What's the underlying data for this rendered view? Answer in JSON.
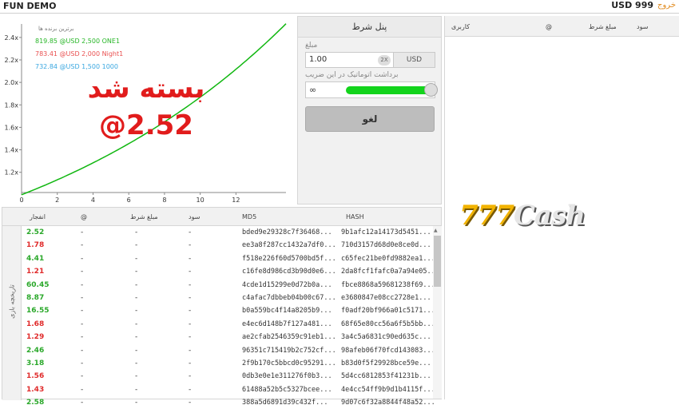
{
  "header": {
    "title": "FUN DEMO",
    "balance": "USD 999",
    "logout": "خروج"
  },
  "chart_data": {
    "type": "line",
    "title": "",
    "xlabel": "",
    "ylabel": "",
    "xlim": [
      0,
      14.8
    ],
    "ylim": [
      1.02,
      2.52
    ],
    "x_ticks": [
      0,
      2,
      4,
      6,
      8,
      10,
      12
    ],
    "y_ticks": [
      1.2,
      1.4,
      1.6,
      1.8,
      2.0,
      2.2,
      2.4
    ],
    "y_tick_labels": [
      "1.2x",
      "1.4x",
      "1.6x",
      "1.8x",
      "2.0x",
      "2.2x",
      "2.4x"
    ],
    "growth_rate": 0.0625,
    "end_x": 14.8,
    "final_multiplier": 2.52,
    "line_color": "#11b711"
  },
  "chart": {
    "leaderboard_title": "برترین برنده ها",
    "winners": [
      {
        "text": "819.85 @USD 2,500 ONE1",
        "color": "#27b627"
      },
      {
        "text": "783.41 @USD 2,000 Night1",
        "color": "#e95050"
      },
      {
        "text": "732.84 @USD 1,500 1000",
        "color": "#3aa7e0"
      }
    ],
    "crashed_label": "بسته شد",
    "crashed_value": "@2.52"
  },
  "bet_panel": {
    "title": "پنل شرط",
    "amount_label": "مبلغ",
    "amount_value": "1.00",
    "double_button": "2X",
    "currency": "USD",
    "auto_cashout_label": "برداشت اتوماتیک در این ضریب",
    "auto_cashout_value": "∞",
    "auto_cashout_level": 1.0,
    "cancel_button": "لغو"
  },
  "players": {
    "headers": {
      "user": "کاربری",
      "at": "@",
      "bet": "مبلغ شرط",
      "profit": "سود"
    },
    "logo_numeric": "777",
    "logo_text": "Cash"
  },
  "history": {
    "side_label": "تاریخچه بازی",
    "headers": {
      "crash": "انفجار",
      "at": "@",
      "bet": "مبلغ شرط",
      "profit": "سود",
      "md5": "MD5",
      "hash": "HASH"
    },
    "colors": {
      "win": "#2aa82a",
      "loss": "#e02a2a"
    },
    "rows": [
      {
        "crash": "2.52",
        "win": true,
        "at": "-",
        "bet": "-",
        "profit": "-",
        "md5": "bded9e29328c7f36468...",
        "hash": "9b1afc12a14173d5451..."
      },
      {
        "crash": "1.78",
        "win": false,
        "at": "-",
        "bet": "-",
        "profit": "-",
        "md5": "ee3a8f287cc1432a7df0...",
        "hash": "710d3157d68d0e8ce0d..."
      },
      {
        "crash": "4.41",
        "win": true,
        "at": "-",
        "bet": "-",
        "profit": "-",
        "md5": "f518e226f60d5700bd5f...",
        "hash": "c65fec21be0fd9882ea1..."
      },
      {
        "crash": "1.21",
        "win": false,
        "at": "-",
        "bet": "-",
        "profit": "-",
        "md5": "c16fe8d986cd3b90d0e6...",
        "hash": "2da8fcf1fafc0a7a94e05..."
      },
      {
        "crash": "60.45",
        "win": true,
        "at": "-",
        "bet": "-",
        "profit": "-",
        "md5": "4cde1d15299e0d72b0a...",
        "hash": "fbce8868a59681238f69..."
      },
      {
        "crash": "8.87",
        "win": true,
        "at": "-",
        "bet": "-",
        "profit": "-",
        "md5": "c4afac7dbbeb04b00c67...",
        "hash": "e3680847e08cc2728e1..."
      },
      {
        "crash": "16.55",
        "win": true,
        "at": "-",
        "bet": "-",
        "profit": "-",
        "md5": "b0a559bc4f14a8205b9...",
        "hash": "f0adf20bf966a01c5171..."
      },
      {
        "crash": "1.68",
        "win": false,
        "at": "-",
        "bet": "-",
        "profit": "-",
        "md5": "e4ec6d148b7f127a481...",
        "hash": "68f65e80cc56a6f5b5bb..."
      },
      {
        "crash": "1.29",
        "win": false,
        "at": "-",
        "bet": "-",
        "profit": "-",
        "md5": "ae2cfab2546359c91eb1...",
        "hash": "3a4c5a6831c90ed635c..."
      },
      {
        "crash": "2.46",
        "win": true,
        "at": "-",
        "bet": "-",
        "profit": "-",
        "md5": "96351c715419b2c752cf...",
        "hash": "98afeb06f70fcd143083..."
      },
      {
        "crash": "3.18",
        "win": true,
        "at": "-",
        "bet": "-",
        "profit": "-",
        "md5": "2f9b170c5bbcd0c95291...",
        "hash": "b83d0f5f29928bce59e..."
      },
      {
        "crash": "1.56",
        "win": false,
        "at": "-",
        "bet": "-",
        "profit": "-",
        "md5": "0db3e0e1e311276f0b3...",
        "hash": "5d4cc6812853f41231b..."
      },
      {
        "crash": "1.43",
        "win": false,
        "at": "-",
        "bet": "-",
        "profit": "-",
        "md5": "61488a52b5c5327bcee...",
        "hash": "4e4cc54ff9b9d1b4115f..."
      },
      {
        "crash": "2.58",
        "win": true,
        "at": "-",
        "bet": "-",
        "profit": "-",
        "md5": "388a5d6891d39c432f...",
        "hash": "9d07c6f32a8844f48a52..."
      }
    ]
  }
}
